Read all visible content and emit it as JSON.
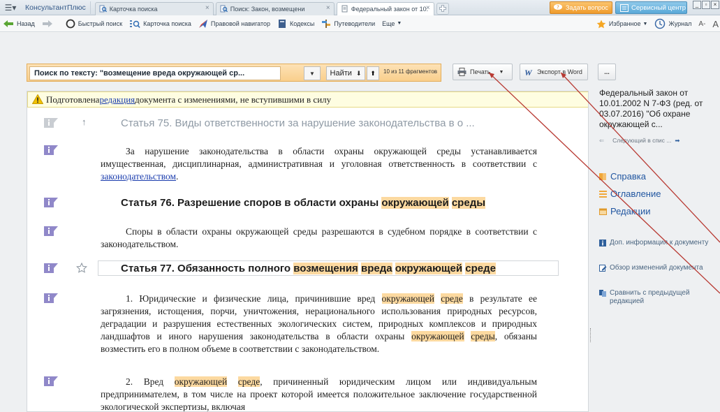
{
  "tabbar": {
    "brand": "КонсультантПлюс",
    "tabs": [
      {
        "label": "Карточка поиска"
      },
      {
        "label": "Поиск: Закон, возмещени"
      },
      {
        "label": "Федеральный закон от 10."
      }
    ],
    "ask_label": "Задать вопрос",
    "service_label": "Сервисный центр"
  },
  "toolbar": {
    "back": "Назад",
    "quick_search": "Быстрый поиск",
    "search_card": "Карточка поиска",
    "legal_navigator": "Правовой навигатор",
    "codes": "Кодексы",
    "guides": "Путеводители",
    "more": "Еще",
    "favorites": "Избранное",
    "journal": "Журнал",
    "font_size": "A-",
    "font_size_big": "A"
  },
  "search": {
    "query": "Поиск по тексту: \"возмещение вреда окружающей ср...",
    "find_label": "Найти",
    "count": "10 из 11 фрагментов"
  },
  "doc_buttons": {
    "print": "Печать",
    "export": "Экспорт в Word",
    "more": "..."
  },
  "notice": {
    "before": "Подготовлена ",
    "link": "редакция",
    "after": " документа с изменениями, не вступившими в силу"
  },
  "document": {
    "art75_title": "Статья 75. Виды ответственности за нарушение законодательства в о ...",
    "art75_para_before": "За нарушение законодательства в области охраны окружающей среды устанавливается имущественная, дисциплинарная, административная и уголовная ответственность в соответствии с ",
    "art75_para_link": "законодательством",
    "art75_para_after": ".",
    "art76_title_before": "Статья 76. Разрешение споров в области охраны ",
    "art76_hl1": "окружающей",
    "art76_hl2": "среды",
    "art76_para": "Споры в области охраны окружающей среды разрешаются в судебном порядке в соответствии с законодательством.",
    "art77_title_before": "Статья 77. Обязанность полного ",
    "art77_hl1": "возмещения",
    "art77_hl2": "вреда",
    "art77_hl3": "окружающей",
    "art77_hl4": "среде",
    "p1_a": "1. Юридические и физические лица, причинившие вред ",
    "p1_hl1": "окружающей",
    "p1_hl2": "среде",
    "p1_b": " в результате ее загрязнения, истощения, порчи, уничтожения, нерационального использования природных ресурсов, деградации и разрушения естественных экологических систем, природных комплексов и природных ландшафтов и иного нарушения законодательства в области охраны ",
    "p1_hl3": "окружающей",
    "p1_hl4": "среды",
    "p1_c": ", обязаны возместить его в полном объеме в соответствии с законодательством.",
    "p2_a": "2. Вред ",
    "p2_hl1": "окружающей",
    "p2_hl2": "среде",
    "p2_b": ", причиненный юридическим лицом или индивидуальным предпринимателем, в том числе на проект которой имеется положительное заключение государственной экологической экспертизы, включая"
  },
  "rightpanel": {
    "title": "Федеральный закон от 10.01.2002 N 7-ФЗ (ред. от 03.07.2016) \"Об охране окружающей с...",
    "next": "Следующий в спис ...",
    "spravka": "Справка",
    "oglavlenie": "Оглавление",
    "redakcii": "Редакции",
    "dop_info": "Доп. информация к документу",
    "obzor": "Обзор изменений документа",
    "compare": "Сравнить с предыдущей редакцией"
  }
}
